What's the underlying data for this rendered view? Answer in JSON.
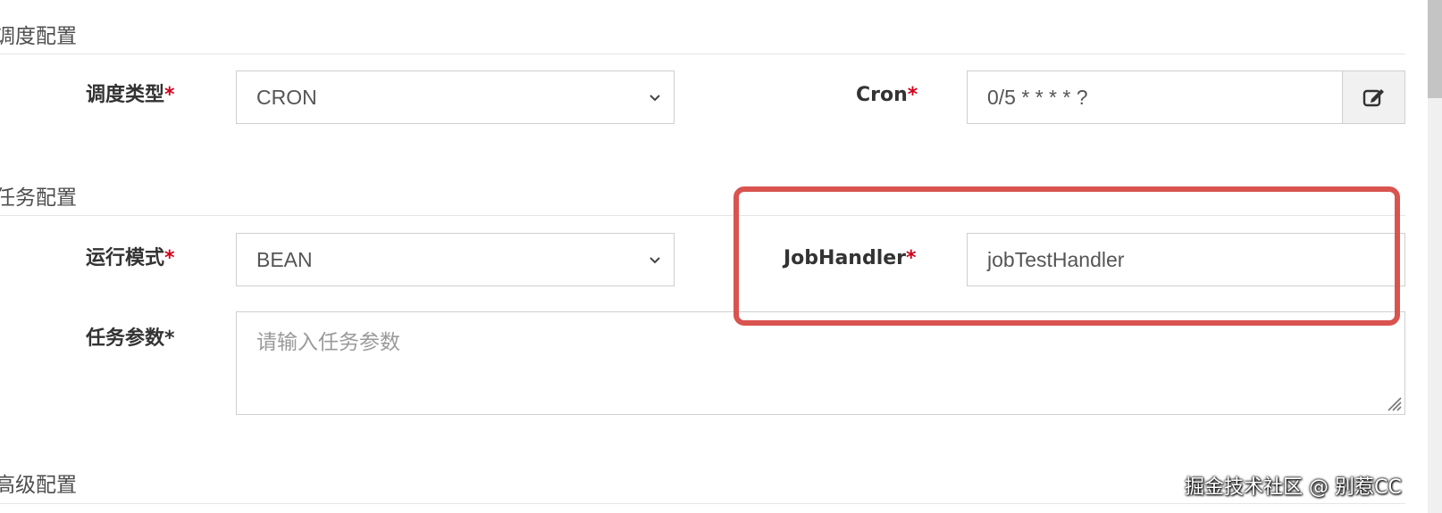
{
  "sections": {
    "schedule": "调度配置",
    "task": "任务配置",
    "advanced": "高级配置"
  },
  "schedule": {
    "type_label": "调度类型",
    "type_value": "CRON",
    "cron_label": "Cron",
    "cron_value": "0/5 * * * * ?",
    "edit_icon": "edit-icon"
  },
  "task": {
    "mode_label": "运行模式",
    "mode_value": "BEAN",
    "handler_label": "JobHandler",
    "handler_value": "jobTestHandler",
    "params_label": "任务参数",
    "params_placeholder": "请输入任务参数"
  },
  "required_mark": "*",
  "watermark": "掘金技术社区 @ 别惹CC",
  "colors": {
    "required": "#d0021b",
    "highlight_border": "#d9534f"
  }
}
